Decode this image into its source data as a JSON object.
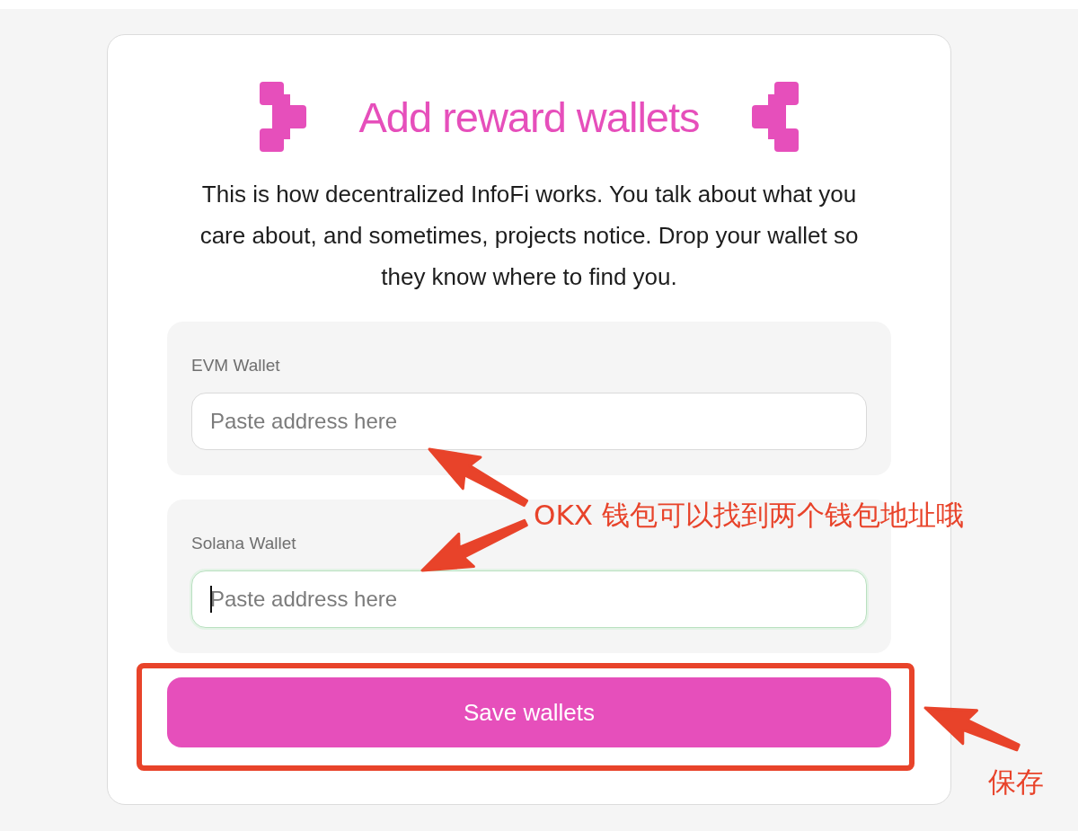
{
  "title": "Add reward wallets",
  "description": "This is how decentralized InfoFi works. You talk about what you care about, and sometimes, projects notice. Drop your wallet so they know where to find you.",
  "fields": [
    {
      "label": "EVM Wallet",
      "placeholder": "Paste address here",
      "focused": false
    },
    {
      "label": "Solana Wallet",
      "placeholder": "Paste address here",
      "focused": true
    }
  ],
  "button": "Save wallets",
  "annotations": [
    {
      "kind": "callout",
      "text": "OKX 钱包可以找到两个钱包地址哦"
    },
    {
      "kind": "label",
      "text": "保存"
    }
  ]
}
